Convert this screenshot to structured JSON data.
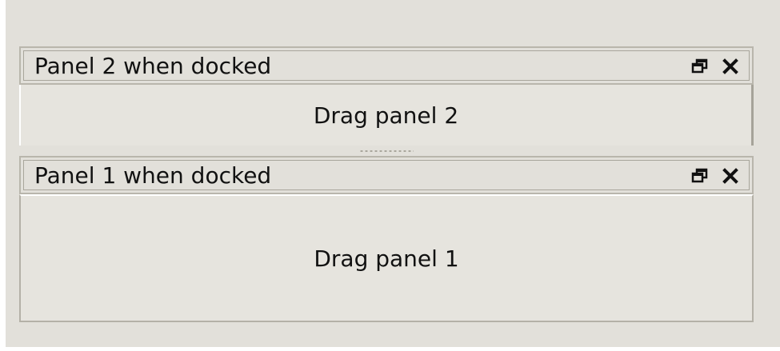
{
  "panel2": {
    "title": "Panel 2 when docked",
    "content_label": "Drag panel 2",
    "float_icon": "float-icon",
    "close_icon": "close-icon"
  },
  "panel1": {
    "title": "Panel 1 when docked",
    "content_label": "Drag panel 1",
    "float_icon": "float-icon",
    "close_icon": "close-icon"
  }
}
